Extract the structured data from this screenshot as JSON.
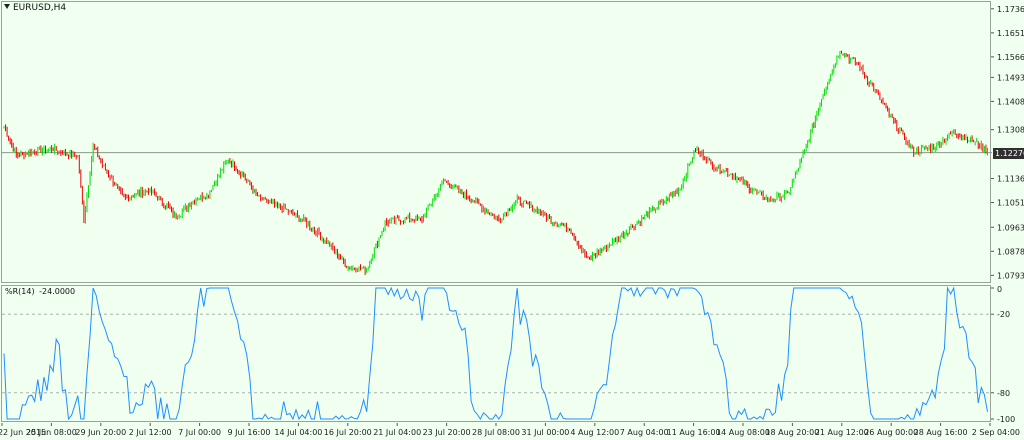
{
  "chart": {
    "symbol": "EURUSD,H4",
    "bid_price": "1.12276",
    "bid_value": 1.12276,
    "colors": {
      "background": "#f0fff0",
      "bull": "#00dd00",
      "bear": "#ee0000",
      "bid_line": "#8a9a8a",
      "indicator_line": "#1e90ff"
    },
    "price_axis": [
      "1.17360",
      "1.16510",
      "1.15660",
      "1.14935",
      "1.14085",
      "1.13085",
      "1.12276",
      "1.11360",
      "1.10510",
      "1.09635",
      "1.08785",
      "1.07935"
    ],
    "price_axis_values": [
      1.1736,
      1.1651,
      1.1566,
      1.14935,
      1.14085,
      1.13085,
      1.1136,
      1.1051,
      1.09635,
      1.08785,
      1.07935
    ],
    "time_axis": [
      "22 Jun 2015",
      "25 Jun 08:00",
      "29 Jun 20:00",
      "2 Jul 12:00",
      "7 Jul 00:00",
      "9 Jul 16:00",
      "14 Jul 04:00",
      "16 Jul 20:00",
      "21 Jul 04:00",
      "23 Jul 20:00",
      "28 Jul 08:00",
      "31 Jul 00:00",
      "4 Aug 12:00",
      "7 Aug 04:00",
      "11 Aug 16:00",
      "14 Aug 08:00",
      "18 Aug 20:00",
      "21 Aug 12:00",
      "26 Aug 00:00",
      "28 Aug 16:00",
      "2 Sep 04:00"
    ]
  },
  "indicator": {
    "name": "%R(14)",
    "value": "-24.0000",
    "levels": [
      "0",
      "-20",
      "-80",
      "-100"
    ],
    "level_values": [
      0,
      -20,
      -80,
      -100
    ]
  },
  "chart_data": {
    "type": "candlestick",
    "series": [
      {
        "name": "EURUSD,H4",
        "anchors_close": [
          [
            0,
            1.132
          ],
          [
            8,
            1.1215
          ],
          [
            20,
            1.1235
          ],
          [
            32,
            1.124
          ],
          [
            40,
            1.1225
          ],
          [
            48,
            1.1215
          ],
          [
            52,
            1.099
          ],
          [
            58,
            1.125
          ],
          [
            64,
            1.1185
          ],
          [
            78,
            1.1065
          ],
          [
            94,
            1.1095
          ],
          [
            106,
            1.104
          ],
          [
            112,
            1.1
          ],
          [
            126,
            1.107
          ],
          [
            132,
            1.1075
          ],
          [
            146,
            1.1205
          ],
          [
            156,
            1.1145
          ],
          [
            166,
            1.1065
          ],
          [
            182,
            1.103
          ],
          [
            196,
            1.0985
          ],
          [
            212,
            1.09
          ],
          [
            224,
            1.082
          ],
          [
            236,
            1.0815
          ],
          [
            248,
            1.098
          ],
          [
            262,
            1.0995
          ],
          [
            272,
            1.099
          ],
          [
            286,
            1.113
          ],
          [
            298,
            1.1085
          ],
          [
            310,
            1.104
          ],
          [
            322,
            1.099
          ],
          [
            334,
            1.106
          ],
          [
            346,
            1.1025
          ],
          [
            356,
            1.099
          ],
          [
            368,
            1.096
          ],
          [
            380,
            1.085
          ],
          [
            396,
            1.091
          ],
          [
            410,
            1.097
          ],
          [
            422,
            1.1025
          ],
          [
            440,
            1.11
          ],
          [
            450,
            1.124
          ],
          [
            462,
            1.118
          ],
          [
            474,
            1.115
          ],
          [
            486,
            1.11
          ],
          [
            498,
            1.106
          ],
          [
            510,
            1.108
          ],
          [
            522,
            1.1245
          ],
          [
            532,
            1.142
          ],
          [
            544,
            1.159
          ],
          [
            556,
            1.1535
          ],
          [
            566,
            1.1455
          ],
          [
            578,
            1.1345
          ],
          [
            592,
            1.123
          ],
          [
            606,
            1.125
          ],
          [
            618,
            1.13
          ],
          [
            630,
            1.127
          ],
          [
            640,
            1.1235
          ]
        ]
      }
    ],
    "ylim": [
      1.077,
      1.176
    ],
    "indicator_series": {
      "name": "%R(14)",
      "ylim": [
        -100,
        0
      ],
      "last": -24.0
    }
  }
}
